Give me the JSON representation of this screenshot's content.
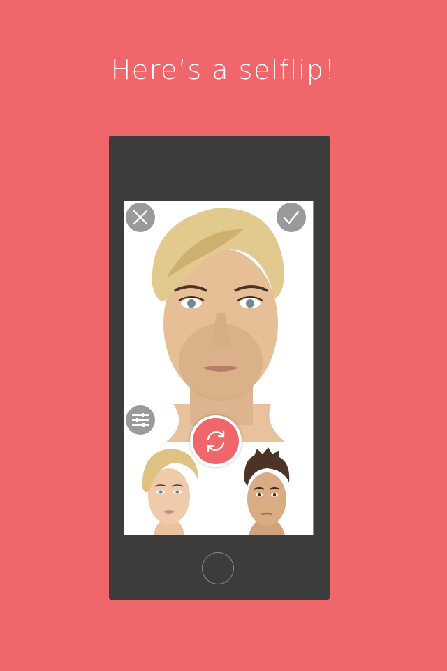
{
  "headline": "Here’s a selflip!",
  "icons": {
    "close": "close-icon",
    "confirm": "checkmark-icon",
    "adjust": "sliders-icon",
    "flip": "refresh-cycle-icon"
  },
  "colors": {
    "background": "#f0676b",
    "phone_body": "#3c3c3d",
    "accent": "#f0676b",
    "overlay_button": "#787878"
  }
}
